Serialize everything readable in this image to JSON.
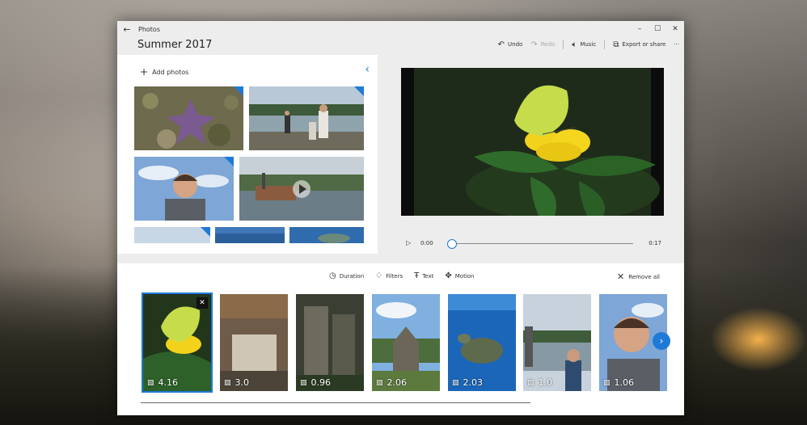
{
  "window": {
    "app_name": "Photos",
    "back_icon": "back-arrow-icon"
  },
  "project": {
    "title": "Summer 2017"
  },
  "toolbar": {
    "undo_label": "Undo",
    "redo_label": "Redo",
    "music_label": "Music",
    "export_label": "Export or share",
    "more_label": "···"
  },
  "library": {
    "add_label": "Add photos"
  },
  "player": {
    "current_time": "0:00",
    "total_time": "0:17",
    "progress": 0
  },
  "storyboard": {
    "tools": {
      "duration": "Duration",
      "filters": "Filters",
      "text": "Text",
      "motion": "Motion"
    },
    "remove_all_label": "Remove all",
    "clips": [
      {
        "duration": "4.16"
      },
      {
        "duration": "3.0"
      },
      {
        "duration": "0.96"
      },
      {
        "duration": "2.06"
      },
      {
        "duration": "2.03"
      },
      {
        "duration": "1.0"
      },
      {
        "duration": "1.06"
      }
    ]
  },
  "colors": {
    "accent": "#1e7ad6",
    "window_bg": "#ededed",
    "panel_bg": "#ffffff"
  }
}
